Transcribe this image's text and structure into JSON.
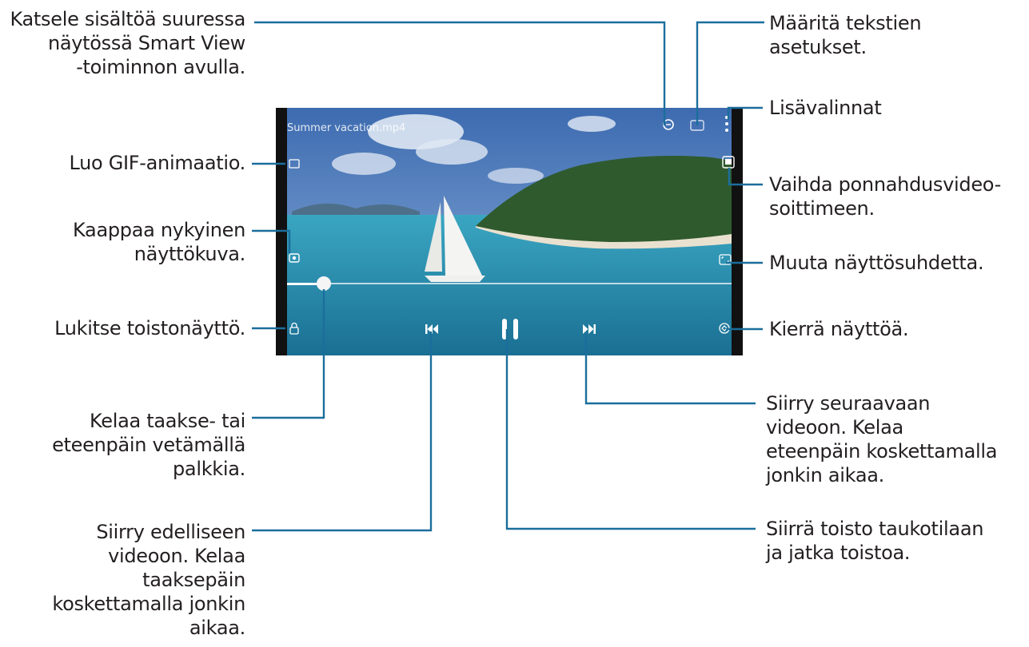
{
  "video": {
    "filename": "Summer vacation.mp4",
    "progress": 0.09
  },
  "callouts": {
    "smart_view": [
      "Katsele sisältöä suuressa",
      "näytössä Smart View",
      "-toiminnon avulla."
    ],
    "subtitles": [
      "Määritä tekstien",
      "asetukset."
    ],
    "more_options": [
      "Lisävalinnat"
    ],
    "gif": [
      "Luo GIF-animaatio."
    ],
    "popup_player": [
      "Vaihda ponnahdusvideo-",
      "soittimeen."
    ],
    "capture": [
      "Kaappaa nykyinen",
      "näyttökuva."
    ],
    "ratio": [
      "Muuta näyttösuhdetta."
    ],
    "lock": [
      "Lukitse toistonäyttö."
    ],
    "rotate": [
      "Kierrä näyttöä."
    ],
    "seek": [
      "Kelaa taakse- tai",
      "eteenpäin vetämällä",
      "palkkia."
    ],
    "next": [
      "Siirry seuraavaan",
      "videoon. Kelaa",
      "eteenpäin koskettamalla",
      "jonkin aikaa."
    ],
    "previous": [
      "Siirry edelliseen",
      "videoon. Kelaa",
      "taaksepäin",
      "koskettamalla jonkin",
      "aikaa."
    ],
    "pause": [
      "Siirrä toisto taukotilaan",
      "ja jatka toistoa."
    ]
  },
  "colors": {
    "leader": "#1b6e9c",
    "text": "#231f20",
    "sea": "#2a8fb0",
    "sky": "#5a86c4"
  },
  "icons": [
    "smart-view-icon",
    "subtitle-icon",
    "more-options-icon",
    "gif-icon",
    "popup-player-icon",
    "capture-icon",
    "ratio-icon",
    "lock-icon",
    "rotate-icon",
    "previous-icon",
    "pause-icon",
    "next-icon"
  ]
}
